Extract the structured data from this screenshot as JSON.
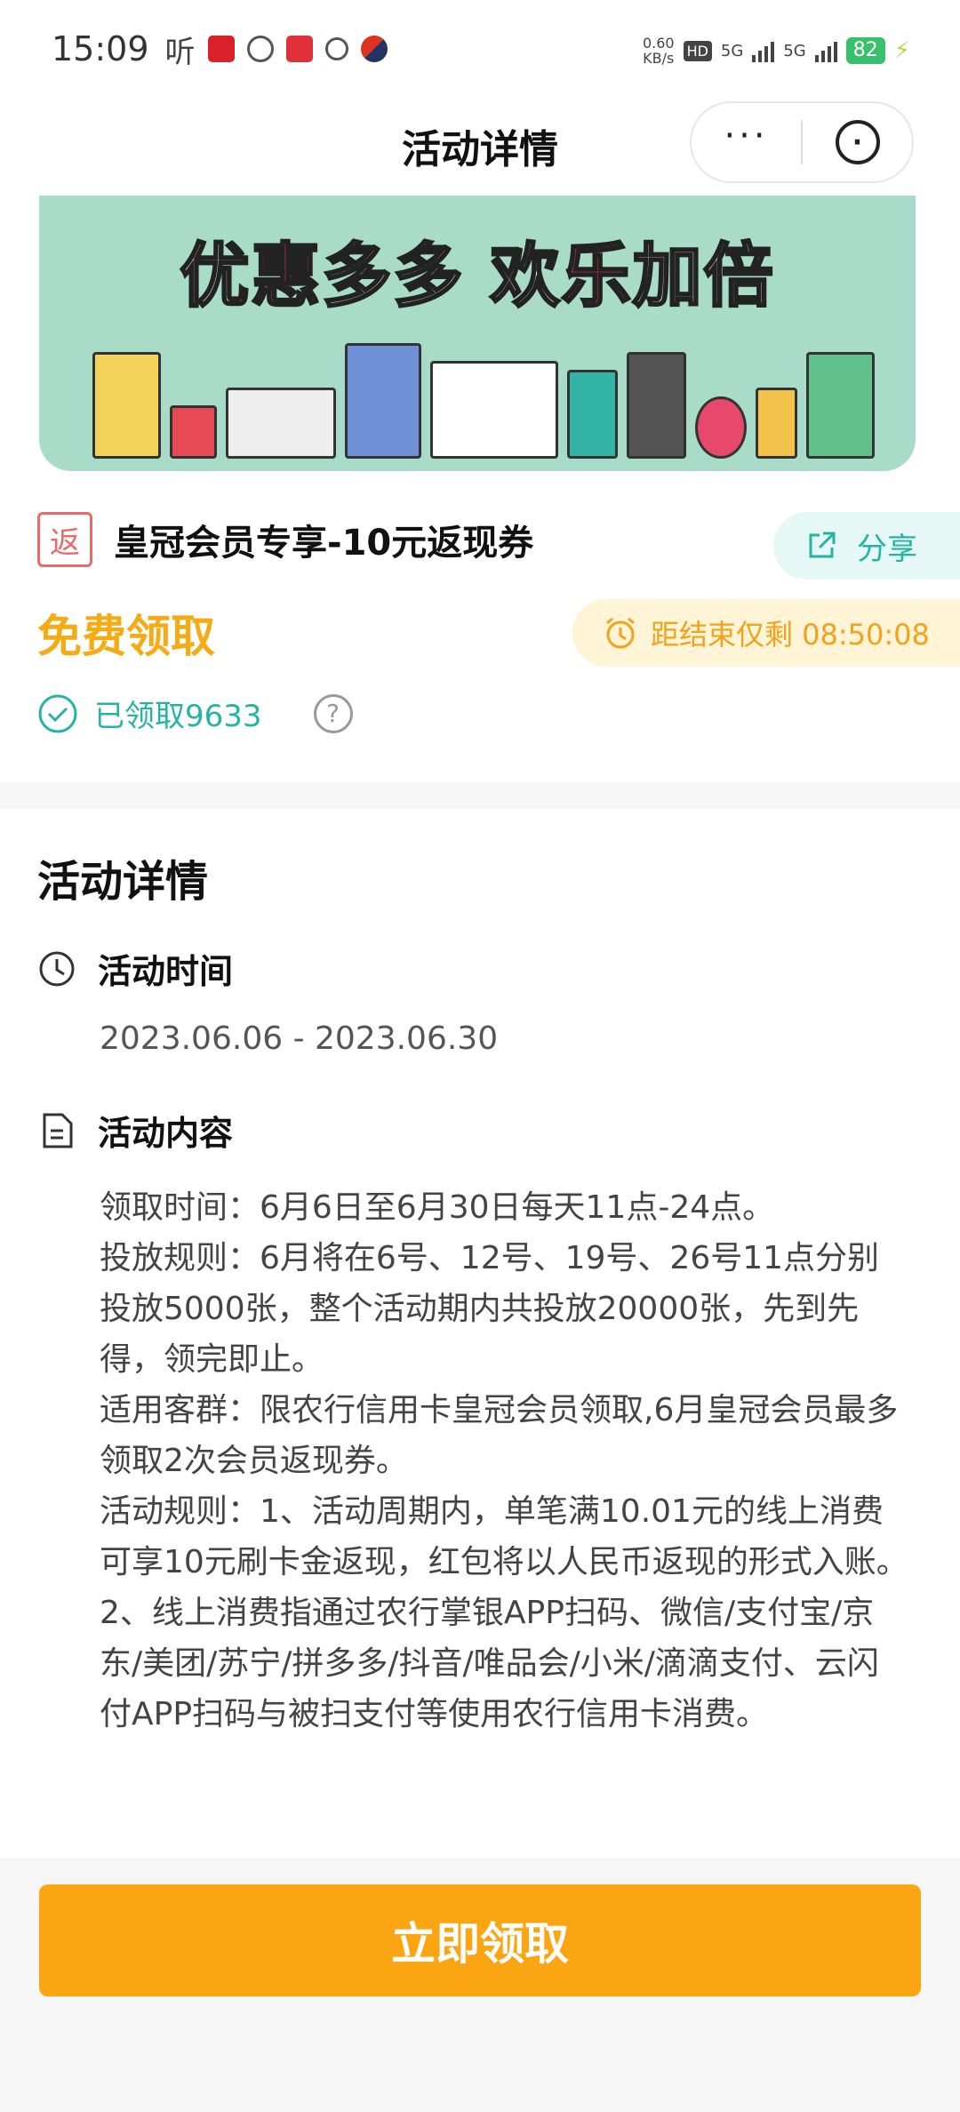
{
  "status_bar": {
    "time": "15:09",
    "ting": "听",
    "net_speed_value": "0.60",
    "net_speed_unit": "KB/s",
    "hd": "HD",
    "sim1": "5G",
    "sim2": "5G",
    "battery": "82"
  },
  "header": {
    "title": "活动详情",
    "more_label": "···"
  },
  "banner": {
    "text_part1": "优",
    "text_part2": "惠",
    "text_part3": "多多 欢",
    "text_part4": "乐",
    "text_part5": "加倍"
  },
  "coupon": {
    "badge": "返",
    "title": "皇冠会员专享-10元返现券",
    "share_label": "分享",
    "price_label": "免费领取",
    "countdown": "距结束仅剩 08:50:08",
    "claimed": "已领取9633",
    "help": "?"
  },
  "details": {
    "title": "活动详情",
    "time_label": "活动时间",
    "time_value": "2023.06.06 - 2023.06.30",
    "content_label": "活动内容",
    "content_lines": [
      "领取时间：6月6日至6月30日每天11点-24点。",
      "投放规则：6月将在6号、12号、19号、26号11点分别投放5000张，整个活动期内共投放20000张，先到先得，领完即止。",
      "适用客群：限农行信用卡皇冠会员领取,6月皇冠会员最多领取2次会员返现券。",
      "活动规则：1、活动周期内，单笔满10.01元的线上消费可享10元刷卡金返现，红包将以人民币返现的形式入账。2、线上消费指通过农行掌银APP扫码、微信/支付宝/京东/美团/苏宁/拼多多/抖音/唯品会/小米/滴滴支付、云闪付APP扫码与被扫支付等使用农行信用卡消费。"
    ]
  },
  "cta": {
    "label": "立即领取"
  },
  "colors": {
    "accent_orange": "#fba512",
    "teal": "#27b3a4",
    "banner_bg": "#a8dcc8"
  }
}
